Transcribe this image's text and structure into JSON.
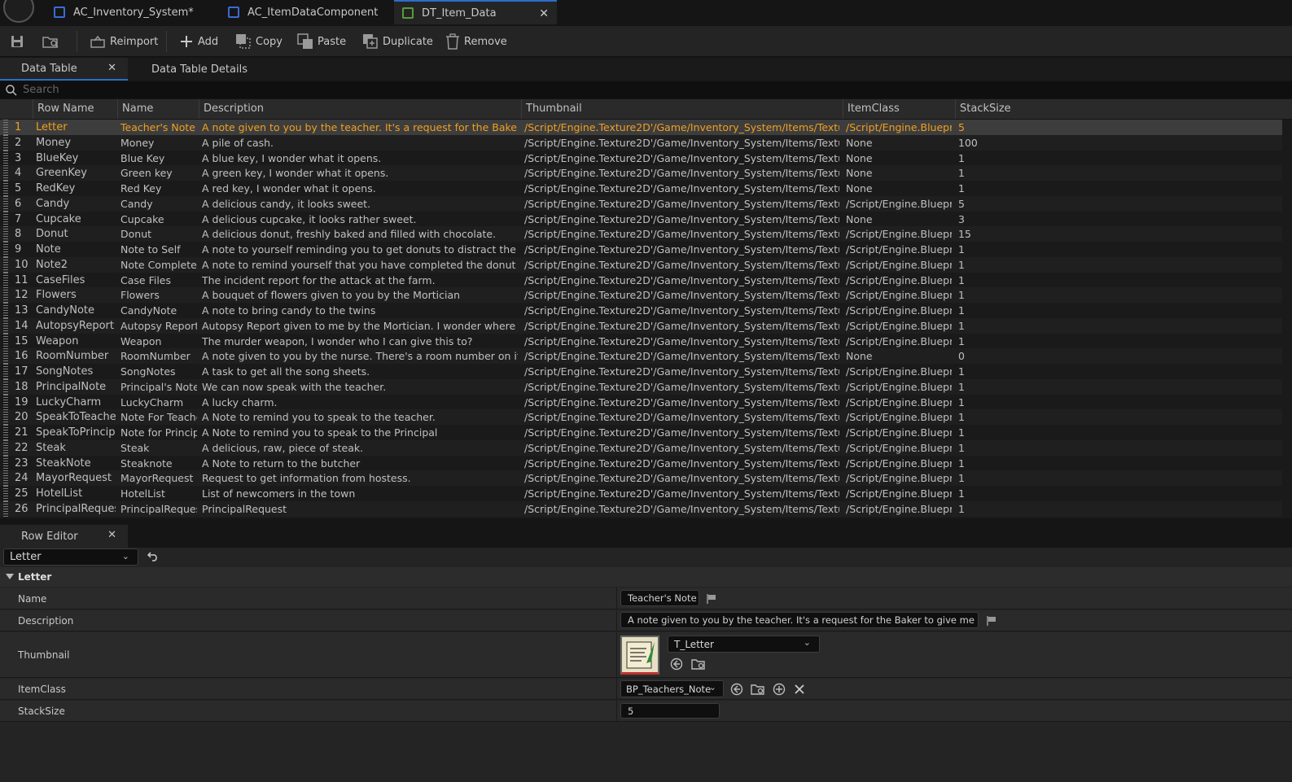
{
  "tabs": [
    {
      "label": "AC_Inventory_System*"
    },
    {
      "label": "AC_ItemDataComponent"
    },
    {
      "label": "DT_Item_Data"
    }
  ],
  "toolbar": {
    "reimport": "Reimport",
    "add": "Add",
    "copy": "Copy",
    "paste": "Paste",
    "duplicate": "Duplicate",
    "remove": "Remove"
  },
  "panels": {
    "data_table": "Data Table",
    "data_table_details": "Data Table Details",
    "row_editor": "Row Editor"
  },
  "search": {
    "placeholder": "Search"
  },
  "columns": [
    "Row Name",
    "Name",
    "Description",
    "Thumbnail",
    "ItemClass",
    "StackSize"
  ],
  "rows": [
    {
      "n": "1",
      "row": "Letter",
      "name": "Teacher's Note",
      "desc": "A note given to you by the teacher. It's a request for the Baker to give me",
      "thumb": "/Script/Engine.Texture2D'/Game/Inventory_System/Items/Textures/T_Let",
      "cls": "/Script/Engine.Blueprint",
      "stack": "5"
    },
    {
      "n": "2",
      "row": "Money",
      "name": "Money",
      "desc": "A pile of cash.",
      "thumb": "/Script/Engine.Texture2D'/Game/Inventory_System/Items/Textures/T_Mo",
      "cls": "None",
      "stack": "100"
    },
    {
      "n": "3",
      "row": "BlueKey",
      "name": "Blue Key",
      "desc": "A blue key, I wonder what it opens.",
      "thumb": "/Script/Engine.Texture2D'/Game/Inventory_System/Items/Textures/T_Blu",
      "cls": "None",
      "stack": "1"
    },
    {
      "n": "4",
      "row": "GreenKey",
      "name": "Green key",
      "desc": "A green key, I wonder what it opens.",
      "thumb": "/Script/Engine.Texture2D'/Game/Inventory_System/Items/Textures/T_Gre",
      "cls": "None",
      "stack": "1"
    },
    {
      "n": "5",
      "row": "RedKey",
      "name": "Red Key",
      "desc": "A red key, I wonder what it opens.",
      "thumb": "/Script/Engine.Texture2D'/Game/Inventory_System/Items/Textures/T_Re",
      "cls": "None",
      "stack": "1"
    },
    {
      "n": "6",
      "row": "Candy",
      "name": "Candy",
      "desc": "A delicious candy, it looks sweet.",
      "thumb": "/Script/Engine.Texture2D'/Game/Inventory_System/Items/Textures/T_Ca",
      "cls": "/Script/Engine.Blueprint",
      "stack": "5"
    },
    {
      "n": "7",
      "row": "Cupcake",
      "name": "Cupcake",
      "desc": "A delicious cupcake, it looks rather sweet.",
      "thumb": "/Script/Engine.Texture2D'/Game/Inventory_System/Items/Textures/T_Cu",
      "cls": "None",
      "stack": "3"
    },
    {
      "n": "8",
      "row": "Donut",
      "name": "Donut",
      "desc": "A delicious donut, freshly baked and filled with chocolate.",
      "thumb": "/Script/Engine.Texture2D'/Game/Inventory_System/Items/Textures/T_Do",
      "cls": "/Script/Engine.Blueprint",
      "stack": "15"
    },
    {
      "n": "9",
      "row": "Note",
      "name": "Note to Self",
      "desc": "A note to yourself reminding you to get donuts to distract the sherrif.",
      "thumb": "/Script/Engine.Texture2D'/Game/Inventory_System/Items/Textures/T_Let",
      "cls": "/Script/Engine.Blueprint",
      "stack": "1"
    },
    {
      "n": "10",
      "row": "Note2",
      "name": "Note Completed",
      "desc": "A note to remind yourself that you have completed the donut quest.",
      "thumb": "/Script/Engine.Texture2D'/Game/Inventory_System/Items/Textures/T_Let",
      "cls": "/Script/Engine.Blueprint",
      "stack": "1"
    },
    {
      "n": "11",
      "row": "CaseFiles",
      "name": "Case Files",
      "desc": "The incident report for the attack at the farm.",
      "thumb": "/Script/Engine.Texture2D'/Game/Inventory_System/Items/Textures/T_Ca",
      "cls": "/Script/Engine.Blueprint",
      "stack": "1"
    },
    {
      "n": "12",
      "row": "Flowers",
      "name": "Flowers",
      "desc": "A bouquet of flowers given to you by the Mortician",
      "thumb": "/Script/Engine.Texture2D'/Game/Inventory_System/Items/Textures/T_Flo",
      "cls": "/Script/Engine.Blueprint",
      "stack": "1"
    },
    {
      "n": "13",
      "row": "CandyNote",
      "name": "CandyNote",
      "desc": "A note to bring candy to the twins",
      "thumb": "/Script/Engine.Texture2D'/Game/Inventory_System/Items/Textures/T_No",
      "cls": "/Script/Engine.Blueprint",
      "stack": "1"
    },
    {
      "n": "14",
      "row": "AutopsyReport",
      "name": "Autopsy Report",
      "desc": "Autopsy Report given to me by the Mortician. I wonder where I could get r",
      "thumb": "/Script/Engine.Texture2D'/Game/Inventory_System/Items/Textures/T_Rep",
      "cls": "/Script/Engine.Blueprint",
      "stack": "1"
    },
    {
      "n": "15",
      "row": "Weapon",
      "name": "Weapon",
      "desc": "The murder weapon, I wonder who I can give this to?",
      "thumb": "/Script/Engine.Texture2D'/Game/Inventory_System/Items/Textures/Sirea",
      "cls": "/Script/Engine.Blueprint",
      "stack": "1"
    },
    {
      "n": "16",
      "row": "RoomNumber",
      "name": "RoomNumber",
      "desc": "A note given to you by the nurse. There's a room number on it.",
      "thumb": "/Script/Engine.Texture2D'/Game/Inventory_System/Items/Textures/T_No",
      "cls": "None",
      "stack": "0"
    },
    {
      "n": "17",
      "row": "SongNotes",
      "name": "SongNotes",
      "desc": "A task to get all the song sheets.",
      "thumb": "/Script/Engine.Texture2D'/Game/Inventory_System/Items/Textures/T_No",
      "cls": "/Script/Engine.Blueprint",
      "stack": "1"
    },
    {
      "n": "18",
      "row": "PrincipalNote",
      "name": "Principal's Note",
      "desc": "We can now speak with the teacher.",
      "thumb": "/Script/Engine.Texture2D'/Game/Inventory_System/Items/Textures/T_No",
      "cls": "/Script/Engine.Blueprint",
      "stack": "1"
    },
    {
      "n": "19",
      "row": "LuckyCharm",
      "name": "LuckyCharm",
      "desc": "A lucky charm.",
      "thumb": "/Script/Engine.Texture2D'/Game/Inventory_System/Items/Textures/icons",
      "cls": "/Script/Engine.Blueprint",
      "stack": "1"
    },
    {
      "n": "20",
      "row": "SpeakToTeacher",
      "name": "Note For Teacher",
      "desc": "A Note to remind you to speak to the teacher.",
      "thumb": "/Script/Engine.Texture2D'/Game/Inventory_System/Items/Textures/T_No",
      "cls": "/Script/Engine.Blueprint",
      "stack": "1"
    },
    {
      "n": "21",
      "row": "SpeakToPrincipal",
      "name": "Note for Principal",
      "desc": "A Note to remind you to speak to the Principal",
      "thumb": "/Script/Engine.Texture2D'/Game/Inventory_System/Items/Textures/T_No",
      "cls": "/Script/Engine.Blueprint",
      "stack": "1"
    },
    {
      "n": "22",
      "row": "Steak",
      "name": "Steak",
      "desc": "A delicious, raw, piece of steak.",
      "thumb": "/Script/Engine.Texture2D'/Game/Inventory_System/Items/Textures/T_Ste",
      "cls": "/Script/Engine.Blueprint",
      "stack": "1"
    },
    {
      "n": "23",
      "row": "SteakNote",
      "name": "Steaknote",
      "desc": "A Note to return to the butcher",
      "thumb": "/Script/Engine.Texture2D'/Game/Inventory_System/Items/Textures/T_No",
      "cls": "/Script/Engine.Blueprint",
      "stack": "1"
    },
    {
      "n": "24",
      "row": "MayorRequest",
      "name": "MayorRequest",
      "desc": "Request to get information from hostess.",
      "thumb": "/Script/Engine.Texture2D'/Game/Inventory_System/Items/Textures/T_Let",
      "cls": "/Script/Engine.Blueprint",
      "stack": "1"
    },
    {
      "n": "25",
      "row": "HotelList",
      "name": "HotelList",
      "desc": "List of newcomers in the town",
      "thumb": "/Script/Engine.Texture2D'/Game/Inventory_System/Items/Textures/T_Let",
      "cls": "/Script/Engine.Blueprint",
      "stack": "1"
    },
    {
      "n": "26",
      "row": "PrincipalRequest",
      "name": "PrincipalRequest",
      "desc": "PrincipalRequest",
      "thumb": "/Script/Engine.Texture2D'/Game/Inventory_System/Items/Textures/T_No",
      "cls": "/Script/Engine.Blueprint",
      "stack": "1"
    }
  ],
  "row_editor": {
    "selected_row": "Letter",
    "section": "Letter",
    "labels": {
      "name": "Name",
      "description": "Description",
      "thumbnail": "Thumbnail",
      "itemclass": "ItemClass",
      "stacksize": "StackSize"
    },
    "values": {
      "name": "Teacher's Note",
      "description": "A note given to you by the teacher. It's a request for the Baker to give me a cupcake.",
      "thumbnail": "T_Letter",
      "itemclass": "BP_Teachers_Note",
      "stacksize": "5"
    }
  },
  "colors": {
    "selected_row_text": "#f0a020",
    "accent": "#2a6dc9"
  }
}
